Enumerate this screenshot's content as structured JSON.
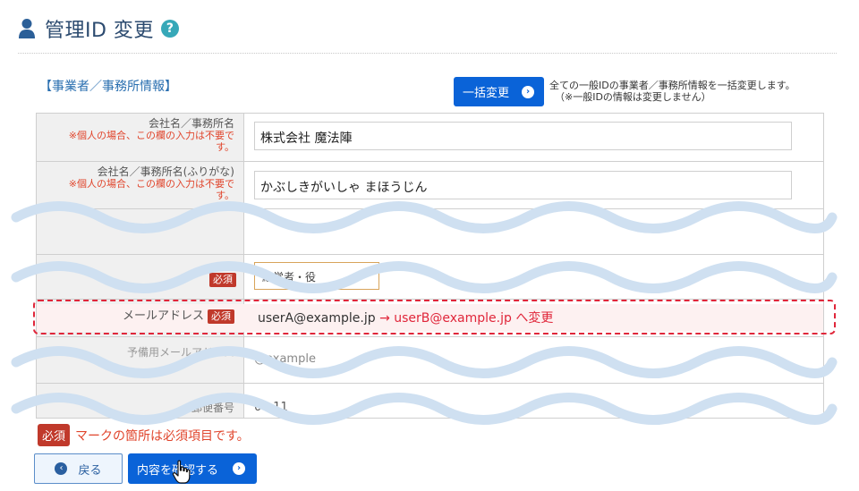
{
  "header": {
    "title": "管理ID 変更",
    "help_icon": "?"
  },
  "section": {
    "label": "【事業者／事務所情報】",
    "bulk_button": "一括変更",
    "bulk_note_line1": "全ての一般IDの事業者／事務所情報を一括変更します。",
    "bulk_note_line2": "（※一般IDの情報は変更しません）"
  },
  "fields": {
    "company": {
      "label": "会社名／事務所名",
      "note": "※個人の場合、この欄の入力は不要で",
      "note2": "す。",
      "value": "株式会社 魔法陣"
    },
    "company_kana": {
      "label": "会社名／事務所名(ふりがな)",
      "note": "※個人の場合、この欄の入力は不要で",
      "note2": "す。",
      "value": "かぶしきがいしゃ まほうじん"
    },
    "position": {
      "required": "必須",
      "value": "経営者・役"
    },
    "email": {
      "label": "メールアドレス",
      "required": "必須",
      "current": "userA@example.jp",
      "change": "→ userB@example.jp へ変更"
    },
    "sub_email": {
      "label": "予備用メールアドレス",
      "value": "@example"
    },
    "postal": {
      "label": "郵便番号",
      "value": "06-11"
    }
  },
  "footer": {
    "required_badge": "必須",
    "note": "マークの箇所は必須項目です。",
    "back_button": "戻る",
    "confirm_button": "内容を確認する"
  }
}
